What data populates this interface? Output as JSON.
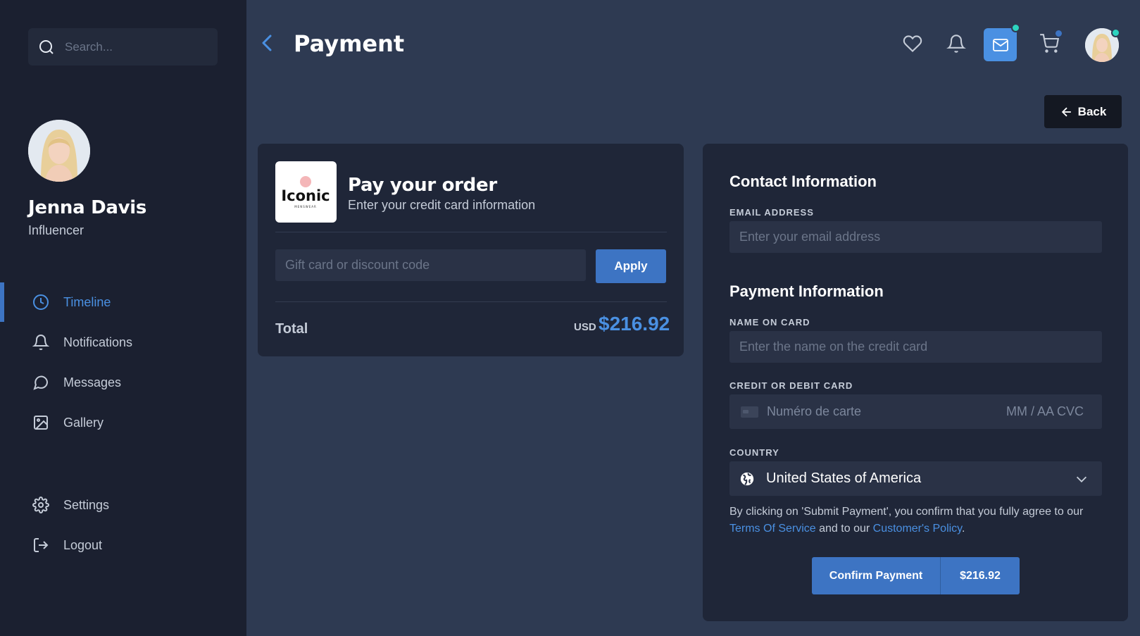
{
  "sidebar": {
    "search_placeholder": "Search...",
    "profile": {
      "name": "Jenna Davis",
      "role": "Influencer"
    },
    "nav": [
      {
        "label": "Timeline",
        "icon": "clock-icon",
        "active": true
      },
      {
        "label": "Notifications",
        "icon": "bell-icon"
      },
      {
        "label": "Messages",
        "icon": "chat-icon"
      },
      {
        "label": "Gallery",
        "icon": "image-icon"
      }
    ],
    "bottom_nav": [
      {
        "label": "Settings",
        "icon": "gear-icon"
      },
      {
        "label": "Logout",
        "icon": "logout-icon"
      }
    ]
  },
  "header": {
    "title": "Payment",
    "icons": [
      "heart-icon",
      "bell-icon",
      "mail-icon",
      "cart-icon"
    ],
    "back_label": "Back"
  },
  "order": {
    "logo_text": "Iconic",
    "logo_subtext": "MENSWEAR",
    "title": "Pay your order",
    "subtitle": "Enter your credit card information",
    "discount_placeholder": "Gift card or discount code",
    "apply_label": "Apply",
    "total_label": "Total",
    "currency": "USD",
    "total_amount": "$216.92"
  },
  "payment": {
    "contact_title": "Contact Information",
    "email_label": "EMAIL ADDRESS",
    "email_placeholder": "Enter your email address",
    "payment_title": "Payment Information",
    "name_label": "NAME ON CARD",
    "name_placeholder": "Enter the name on the credit card",
    "card_label": "CREDIT OR DEBIT CARD",
    "card_number_placeholder": "Numéro de carte",
    "card_expiry_cvc": "MM / AA  CVC",
    "country_label": "COUNTRY",
    "country_value": "United States of America",
    "terms_text_1": "By clicking on 'Submit Payment', you confirm that you fully agree to our ",
    "terms_link_1": "Terms Of Service",
    "terms_text_2": " and to our ",
    "terms_link_2": "Customer's Policy",
    "terms_text_3": ".",
    "confirm_label": "Confirm Payment",
    "confirm_amount": "$216.92"
  },
  "colors": {
    "accent": "#4a90e2",
    "button": "#3d74c3",
    "sidebar_bg": "#1b2030",
    "page_bg": "#2e3a52",
    "card_bg": "#1f2638",
    "notify_dot_teal": "#2dd4bf",
    "notify_dot_blue": "#3d74c3"
  }
}
